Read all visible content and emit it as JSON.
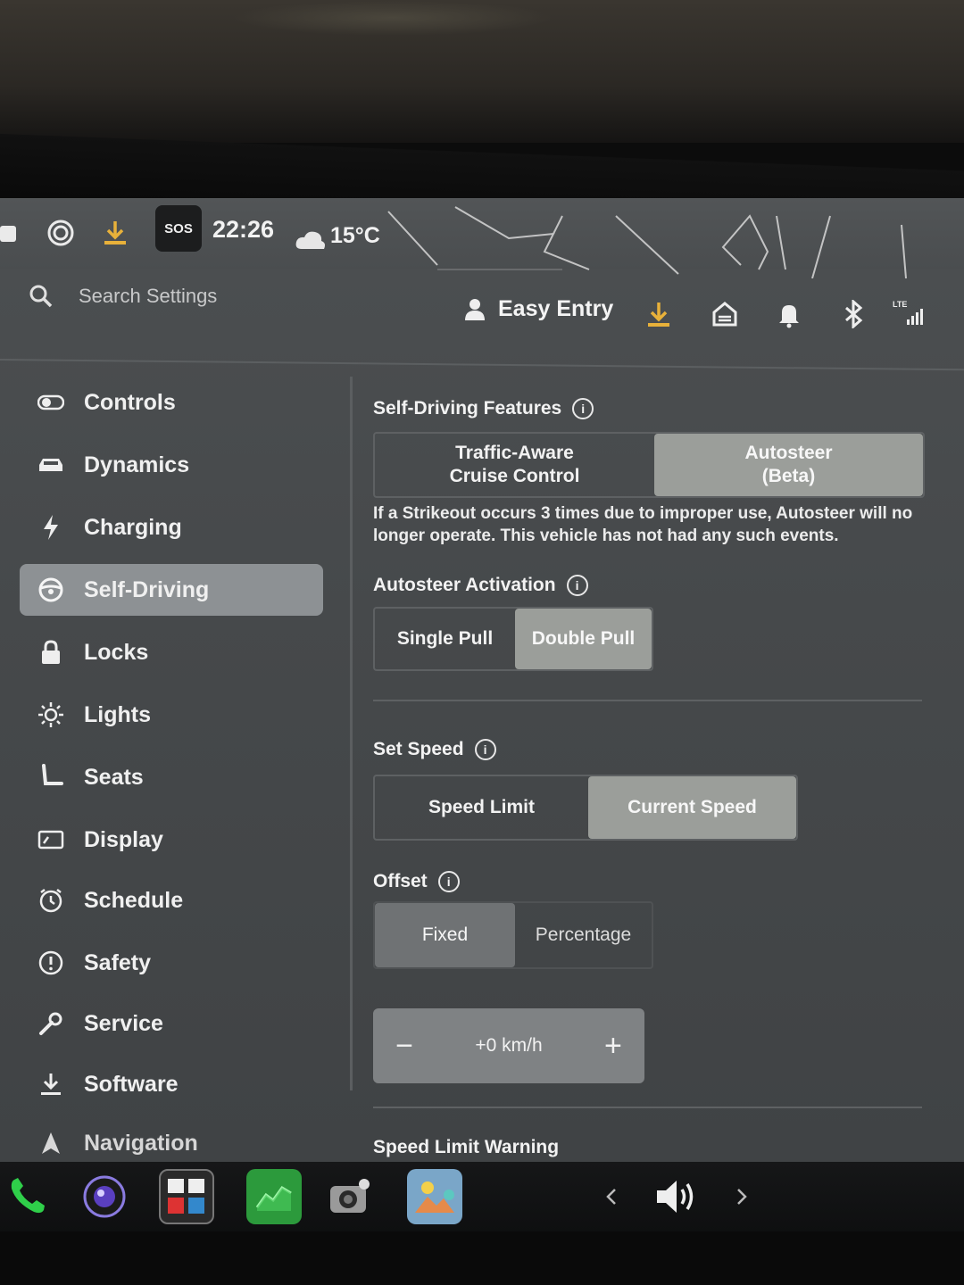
{
  "status": {
    "clock": "22:26",
    "temperature": "15°C",
    "sos_label": "SOS",
    "lte_label": "LTE"
  },
  "header": {
    "search_placeholder": "Search Settings",
    "profile_name": "Easy Entry"
  },
  "sidebar": {
    "items": [
      {
        "label": "Controls",
        "icon": "toggle-icon",
        "active": false
      },
      {
        "label": "Dynamics",
        "icon": "car-icon",
        "active": false
      },
      {
        "label": "Charging",
        "icon": "bolt-icon",
        "active": false
      },
      {
        "label": "Self-Driving",
        "icon": "steering-wheel-icon",
        "active": true
      },
      {
        "label": "Locks",
        "icon": "lock-icon",
        "active": false
      },
      {
        "label": "Lights",
        "icon": "sun-icon",
        "active": false
      },
      {
        "label": "Seats",
        "icon": "seat-icon",
        "active": false
      },
      {
        "label": "Display",
        "icon": "display-icon",
        "active": false
      },
      {
        "label": "Schedule",
        "icon": "clock-icon",
        "active": false
      },
      {
        "label": "Safety",
        "icon": "alert-icon",
        "active": false
      },
      {
        "label": "Service",
        "icon": "wrench-icon",
        "active": false
      },
      {
        "label": "Software",
        "icon": "download-icon",
        "active": false
      },
      {
        "label": "Navigation",
        "icon": "navigation-icon",
        "active": false
      }
    ]
  },
  "main": {
    "self_driving_features": {
      "title": "Self-Driving Features",
      "option_1": "Traffic-Aware\nCruise Control",
      "option_2": "Autosteer\n(Beta)",
      "selected": "option_2",
      "description": "If a Strikeout occurs 3 times due to improper use, Autosteer will no longer operate. This vehicle has not had any such events."
    },
    "autosteer_activation": {
      "title": "Autosteer Activation",
      "option_1": "Single Pull",
      "option_2": "Double Pull",
      "selected": "option_2"
    },
    "set_speed": {
      "title": "Set Speed",
      "option_1": "Speed Limit",
      "option_2": "Current Speed",
      "selected": "option_2"
    },
    "offset": {
      "title": "Offset",
      "option_1": "Fixed",
      "option_2": "Percentage",
      "selected": "option_1",
      "value": "+0 km/h",
      "minus": "−",
      "plus": "+"
    },
    "speed_limit_warning": {
      "title": "Speed Limit Warning"
    }
  },
  "colors": {
    "screen_bg": "#46494b",
    "selected_segment": "#9b9e9a",
    "active_nav": "#8d9194",
    "download_accent": "#e8b13a",
    "phone_green": "#2fcf4a"
  }
}
